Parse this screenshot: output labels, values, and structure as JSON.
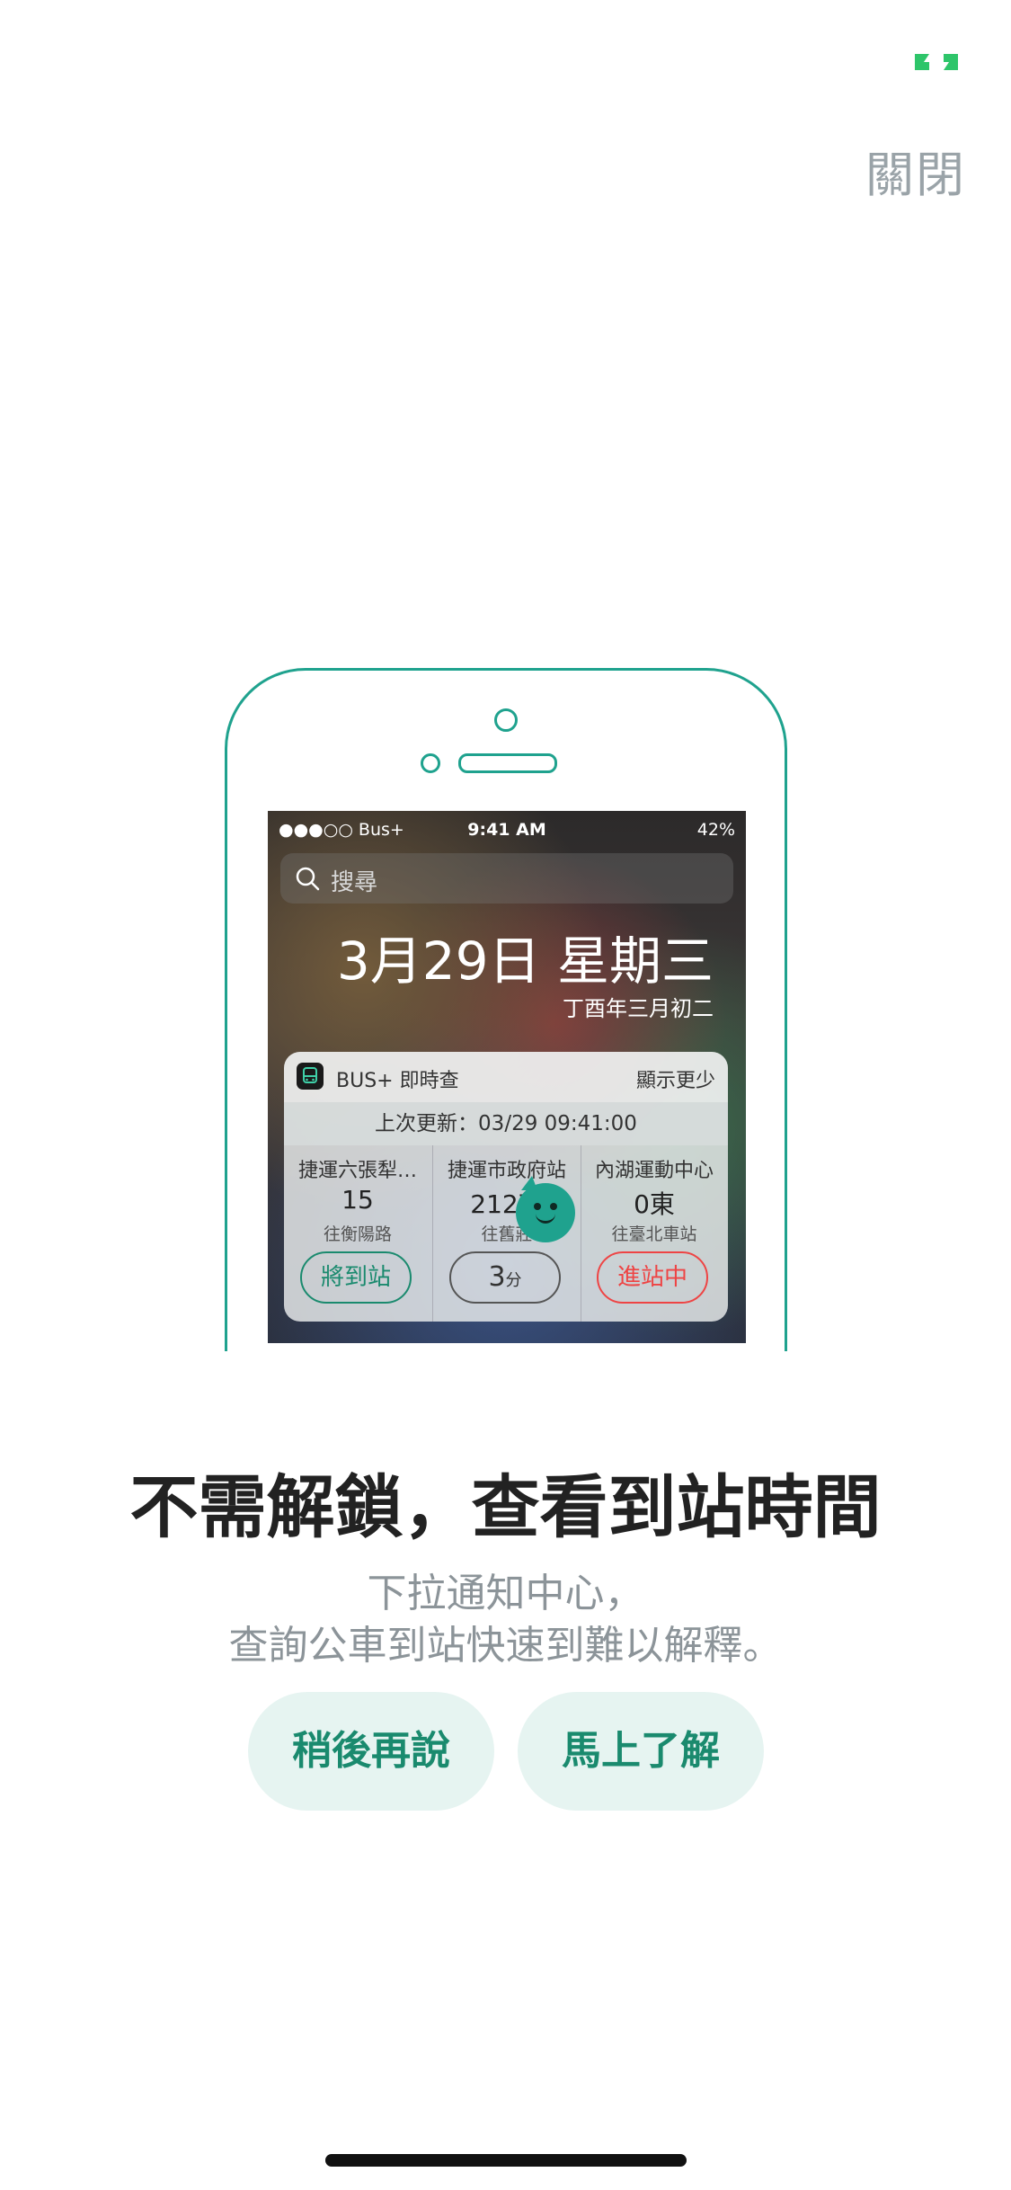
{
  "header": {
    "close_label": "關閉"
  },
  "illustration": {
    "status_bar": {
      "left": "●●●○○ Bus+",
      "time": "9:41 AM",
      "right": "42%"
    },
    "search_placeholder": "搜尋",
    "date": "3月29日 星期三",
    "lunar_date": "丁酉年三月初二",
    "widget": {
      "title": "BUS+ 即時查",
      "show_less": "顯示更少",
      "last_update": "上次更新：03/29 09:41:00",
      "stops": [
        {
          "name": "捷運六張犁…",
          "route": "15",
          "destination": "往衡陽路",
          "eta": "將到站"
        },
        {
          "name": "捷運市政府站",
          "route": "212夜",
          "destination": "往舊莊",
          "eta_value": "3",
          "eta_unit": "分"
        },
        {
          "name": "內湖運動中心",
          "route": "0東",
          "destination": "往臺北車站",
          "eta": "進站中"
        }
      ]
    }
  },
  "content": {
    "headline": "不需解鎖，查看到站時間",
    "subtext_line1": "下拉通知中心，",
    "subtext_line2": "查詢公車到站快速到難以解釋。",
    "later_button": "稍後再說",
    "learn_button": "馬上了解"
  },
  "icons": [
    "status-indicator-icon",
    "search-icon",
    "bus-app-icon",
    "mascot-icon"
  ],
  "colors": {
    "accent": "#1fa28e",
    "button_bg": "#e6f4f1",
    "button_text": "#1a8a6e",
    "alert": "#e44444"
  }
}
